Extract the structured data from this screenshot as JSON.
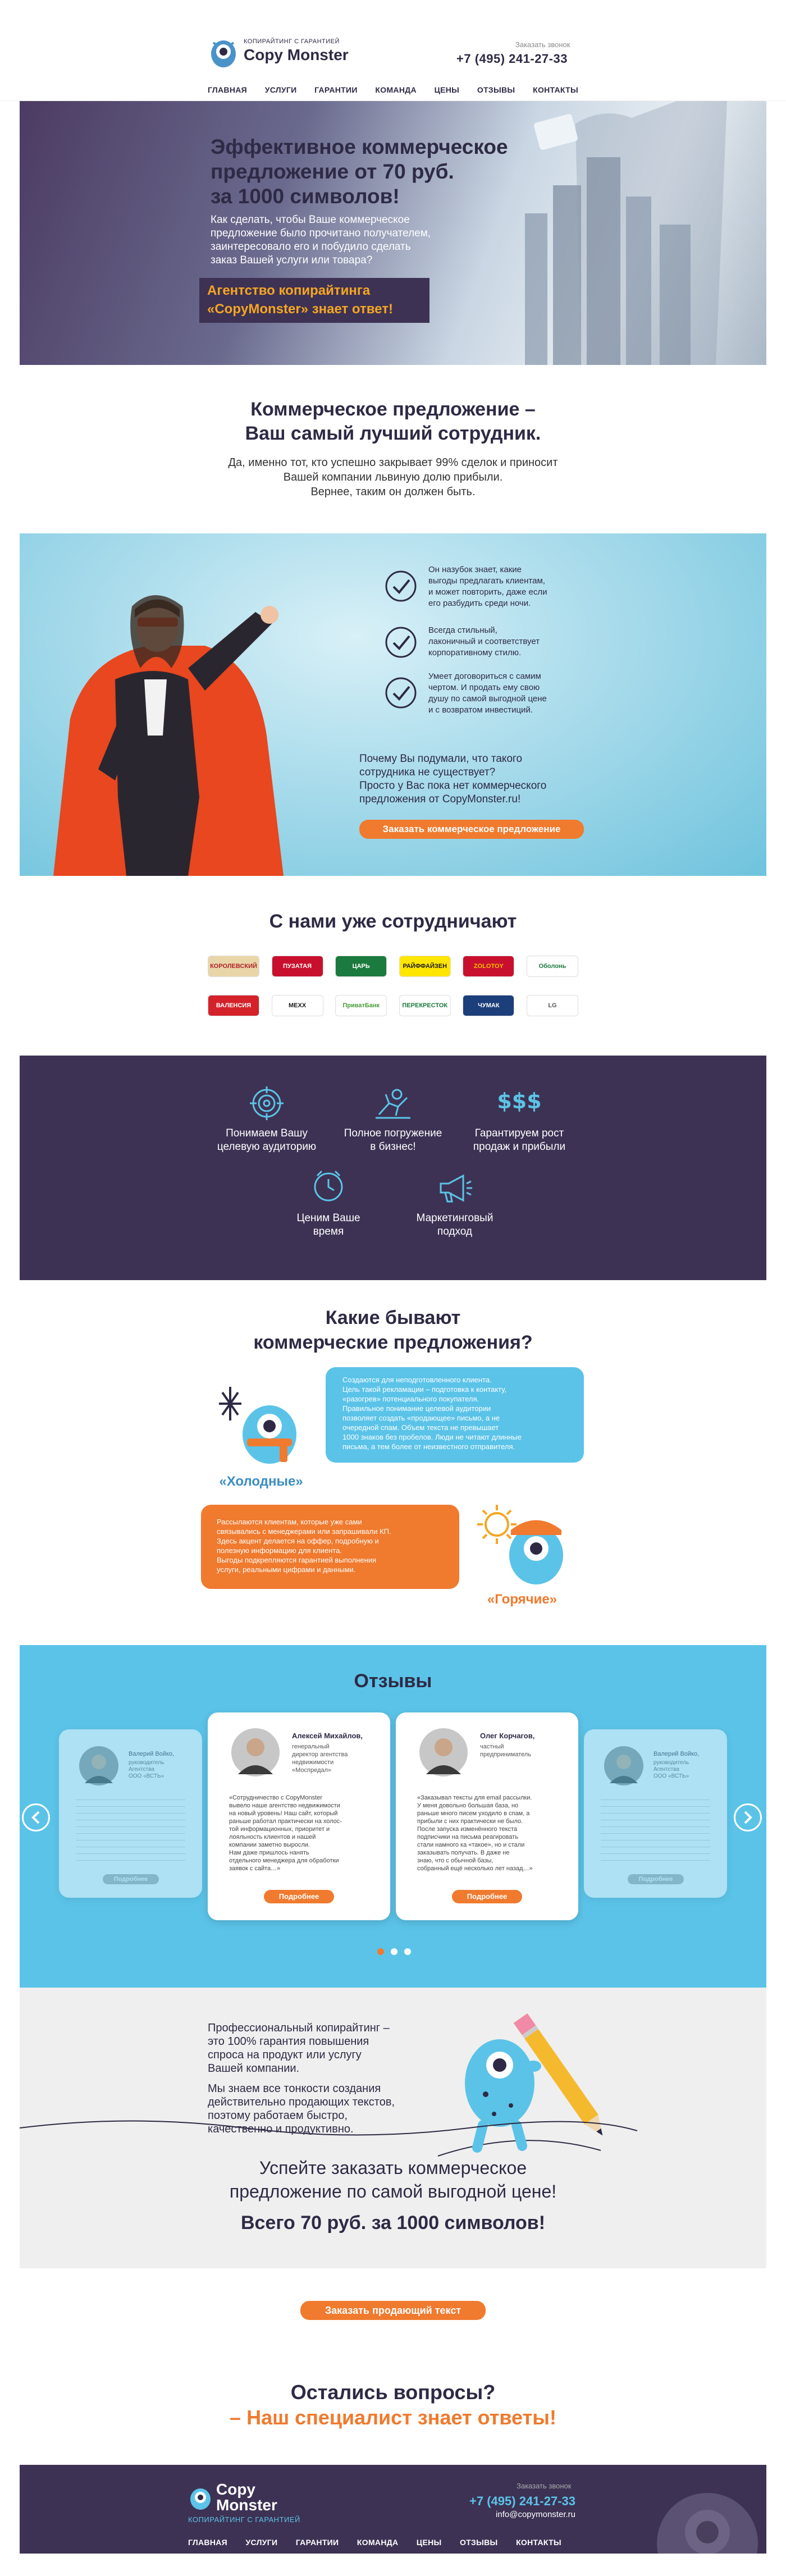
{
  "header": {
    "tagline": "КОПИРАЙТИНГ С ГАРАНТИЕЙ",
    "brand": "Copy Monster",
    "callback": "Заказать звонок",
    "phone": "+7 (495) 241-27-33",
    "nav": [
      "ГЛАВНАЯ",
      "УСЛУГИ",
      "ГАРАНТИИ",
      "КОМАНДА",
      "ЦЕНЫ",
      "ОТЗЫВЫ",
      "КОНТАКТЫ"
    ]
  },
  "hero": {
    "title_l1": "Эффективное коммерческое",
    "title_l2": "предложение от 70 руб.",
    "title_l3": "за 1000 символов!",
    "text_l1": "Как сделать, чтобы Ваше коммерческое",
    "text_l2": "предложение было прочитано получателем,",
    "text_l3": "заинтересовало его и побудило сделать",
    "text_l4": "заказ Вашей услуги или товара?",
    "banner_l1": "Агентство копирайтинга",
    "banner_l2": "«CopyMonster» знает ответ!"
  },
  "employee": {
    "title_l1": "Коммерческое предложение –",
    "title_l2": "Ваш самый лучший сотрудник.",
    "text_l1": "Да, именно тот, кто успешно закрывает 99% сделок и приносит",
    "text_l2": "Вашей компании львиную долю прибыли.",
    "text_l3": "Вернее, таким он должен быть."
  },
  "superhero": {
    "checks": [
      {
        "l1": "Он назубок знает, какие",
        "l2": "выгоды предлагать клиентам,",
        "l3": "и может повторить, даже если",
        "l4": "его разбудить среди ночи."
      },
      {
        "l1": "Всегда стильный,",
        "l2": "лаконичный и соответствует",
        "l3": "корпоративному стилю.",
        "l4": ""
      },
      {
        "l1": "Умеет договориться с самим",
        "l2": "чертом. И продать ему свою",
        "l3": "душу по самой выгодной цене",
        "l4": "и с возвратом инвестиций."
      }
    ],
    "question_l1": "Почему Вы подумали, что такого",
    "question_l2": "сотрудника не существует?",
    "question_l3": "Просто у Вас пока нет коммерческого",
    "question_l4": "предложения от CopyMonster.ru!",
    "cta": "Заказать коммерческое предложение"
  },
  "partners": {
    "title": "С нами уже сотрудничают",
    "row1": [
      {
        "label": "КОРОЛЕВСКИЙ",
        "color": "#e9d6a8",
        "text": "#b0222b"
      },
      {
        "label": "ПУЗАТАЯ",
        "color": "#c8102e",
        "text": "#ffffff"
      },
      {
        "label": "ЦАРЬ",
        "color": "#1b7a3d",
        "text": "#ffffff"
      },
      {
        "label": "РАЙФФАЙЗЕН",
        "color": "#ffe600",
        "text": "#1a1a1a"
      },
      {
        "label": "ZOLOTOY",
        "color": "#c8102e",
        "text": "#f5c200"
      },
      {
        "label": "Оболонь",
        "color": "#ffffff",
        "text": "#1b7a3d"
      }
    ],
    "row2": [
      {
        "label": "ВАЛЕНСИЯ",
        "color": "#d3222a",
        "text": "#ffffff"
      },
      {
        "label": "MEXX",
        "color": "#ffffff",
        "text": "#1a1a1a"
      },
      {
        "label": "ПриватБанк",
        "color": "#ffffff",
        "text": "#4a9b3a"
      },
      {
        "label": "ПЕРЕКРЕСТОК",
        "color": "#ffffff",
        "text": "#1b7a3d"
      },
      {
        "label": "ЧУМАК",
        "color": "#1c3e7a",
        "text": "#ffffff"
      },
      {
        "label": "LG",
        "color": "#ffffff",
        "text": "#555555"
      }
    ]
  },
  "features": [
    {
      "l1": "Понимаем Вашу",
      "l2": "целевую аудиторию",
      "icon": "target-icon"
    },
    {
      "l1": "Полное погружение",
      "l2": "в бизнес!",
      "icon": "diver-icon"
    },
    {
      "l1": "Гарантируем рост",
      "l2": "продаж и прибыли",
      "icon": "dollar-icon"
    },
    {
      "l1": "Ценим Ваше",
      "l2": "время",
      "icon": "clock-icon"
    },
    {
      "l1": "Маркетинговый",
      "l2": "подход",
      "icon": "megaphone-icon"
    }
  ],
  "types": {
    "title_l1": "Какие бывают",
    "title_l2": "коммерческие предложения?",
    "cold_label": "«Холодные»",
    "cold_text": [
      "Создаются для неподготовленного клиента.",
      "Цель такой рекламации – подготовка к контакту,",
      "«разогрев» потенциального покупателя.",
      "Правильное понимание целевой аудитории",
      "позволяет создать «продающее» письмо, а не",
      "очередной спам. Объем текста не превышает",
      "1000 знаков без пробелов. Люди не читают длинные",
      "письма, а тем более от неизвестного отправителя."
    ],
    "hot_label": "«Горячие»",
    "hot_text": [
      "Рассылаются клиентам, которые уже сами",
      "связывались с менеджерами или запрашивали КП.",
      "Здесь акцент делается на оффер, подробную и",
      "полезную информацию для клиента.",
      "Выгоды подкрепляются гарантией выполнения",
      "услуги, реальными цифрами и данными."
    ]
  },
  "reviews": {
    "title": "Отзывы",
    "more": "Подробнее",
    "side_left": {
      "name": "Валерий Войко,",
      "role": [
        "руководитель",
        "Агентства",
        "ООО «ВСТЬ»"
      ]
    },
    "side_right": {
      "name": "Валерий Войко,",
      "role": [
        "руководитель",
        "Агентства",
        "ООО «ВСТЬ»"
      ]
    },
    "main": [
      {
        "name": "Алексей Михайлов,",
        "role": [
          "генеральный",
          "директор агентства",
          "недвижимости",
          "«Моспредал»"
        ],
        "text": [
          "«Сотрудничество с CopyMonster",
          "вывело наше агентство недвижимости",
          "на новый уровень! Наш сайт, который",
          "раньше работал практически на холос-",
          "той информационных, приоритет и",
          "лояльность клиентов и нашей",
          "компании заметно выросли.",
          "Нам даже пришлось нанять",
          "отдельного менеджера для обработки",
          "заявок с сайта…»"
        ]
      },
      {
        "name": "Олег Корчагов,",
        "role": [
          "частный",
          "предприниматель"
        ],
        "text": [
          "«Заказывал тексты для email рассылки.",
          "У меня довольно большая база, но",
          "раньше много писем уходило в спам, а",
          "прибыли с них практически не было.",
          "После запуска изменённого текста",
          "подписчики на письма реагировать",
          "стали намного ка «такое», но и стали",
          "заказывать получать. В даже не",
          "знаю, что с обычной базы,",
          "собранный ещё несколько лет назад…»"
        ]
      }
    ]
  },
  "pro": {
    "p1": [
      "Профессиональный копирайтинг –",
      "это 100% гарантия повышения",
      "спроса на продукт или услугу",
      "Вашей компании."
    ],
    "p2": [
      "Мы знаем все тонкости создания",
      "действительно продающих текстов,",
      "поэтому работаем быстро,",
      "качественно и продуктивно."
    ]
  },
  "order": {
    "title_l1": "Успейте заказать коммерческое",
    "title_l2": "предложение по самой выгодной цене!",
    "price": "Всего 70 руб. за 1000 символов!",
    "cta": "Заказать продающий текст"
  },
  "questions": {
    "title": "Остались вопросы?",
    "subtitle": "– Наш специалист знает ответы!"
  },
  "footer": {
    "brand_l1": "Copy",
    "brand_l2": "Monster",
    "tagline": "КОПИРАЙТИНГ С ГАРАНТИЕЙ",
    "callback": "Заказать звонок",
    "phone": "+7 (495) 241-27-33",
    "email": "info@copymonster.ru",
    "nav": [
      "ГЛАВНАЯ",
      "УСЛУГИ",
      "ГАРАНТИИ",
      "КОМАНДА",
      "ЦЕНЫ",
      "ОТЗЫВЫ",
      "КОНТАКТЫ"
    ]
  },
  "colors": {
    "purple": "#3d3254",
    "orange": "#f07a2e",
    "blue": "#5bc3e8",
    "navy": "#2e2a45"
  }
}
